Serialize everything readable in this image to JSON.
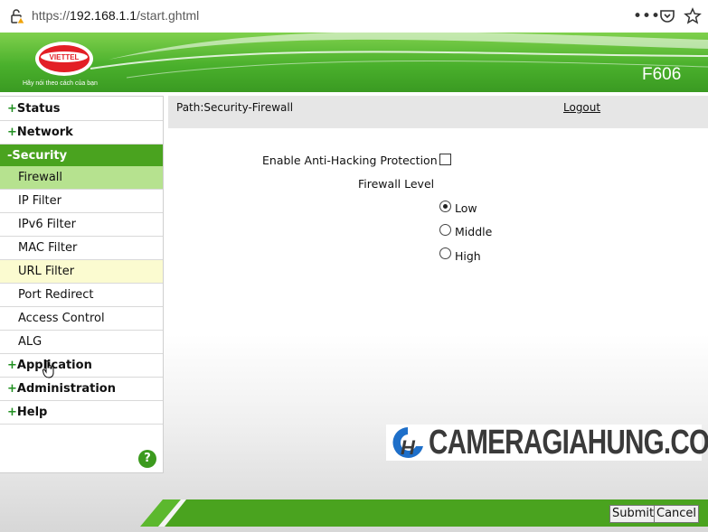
{
  "browser": {
    "url_prefix": "https://",
    "url_host": "192.168.1.1",
    "url_path": "/start.ghtml",
    "icons": [
      "lock-warning-icon",
      "more-icon",
      "pocket-icon",
      "bookmark-star-icon"
    ]
  },
  "header": {
    "brand": "VIETTEL",
    "slogan": "Hãy nói theo cách của bạn",
    "model": "F606"
  },
  "sidebar": {
    "groups": [
      {
        "sign": "+",
        "label": "Status"
      },
      {
        "sign": "+",
        "label": "Network"
      },
      {
        "sign": "-",
        "label": "Security"
      },
      {
        "sign": "+",
        "label": "Application"
      },
      {
        "sign": "+",
        "label": "Administration"
      },
      {
        "sign": "+",
        "label": "Help"
      }
    ],
    "security_items": [
      "Firewall",
      "IP Filter",
      "IPv6 Filter",
      "MAC Filter",
      "URL Filter",
      "Port Redirect",
      "Access Control",
      "ALG"
    ],
    "help_icon": "?"
  },
  "content": {
    "path": "Path:Security-Firewall",
    "logout": "Logout",
    "anti_hacking_label": "Enable Anti-Hacking Protection",
    "anti_hacking_checked": false,
    "firewall_level_label": "Firewall Level",
    "levels": [
      "Low",
      "Middle",
      "High"
    ],
    "selected_level": "Low"
  },
  "watermark": {
    "text": "CAMERAGIAHUNG.COM"
  },
  "footer": {
    "submit": "Submit",
    "cancel": "Cancel"
  },
  "colors": {
    "brand_green": "#4aa31f",
    "active_item": "#b6e28f",
    "hover_item": "#fbfbd0"
  }
}
